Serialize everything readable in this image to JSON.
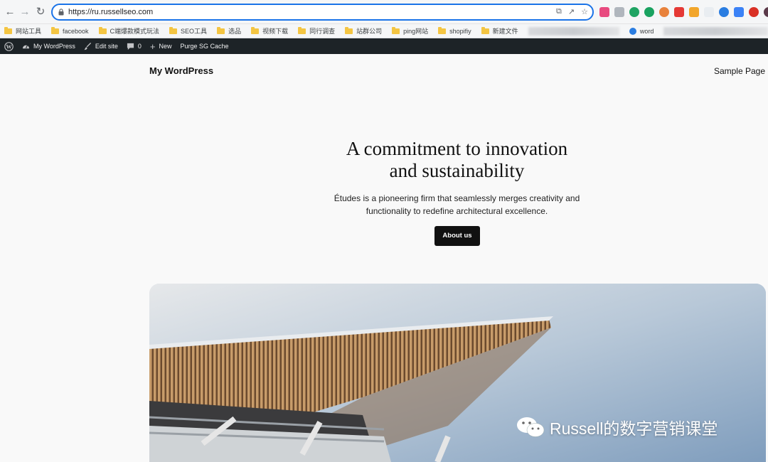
{
  "browser": {
    "url": "https://ru.russellseo.com",
    "bookmarks": [
      "网站工具",
      "facebook",
      "C端爆款模式玩法",
      "SEO工具",
      "选品",
      "视频下载",
      "同行调查",
      "站群公司",
      "ping网站",
      "shopifiy",
      "新建文件",
      "word"
    ]
  },
  "adminbar": {
    "site_label": "My WordPress",
    "edit_label": "Edit site",
    "comments_count": "0",
    "new_label": "New",
    "cache_label": "Purge SG Cache"
  },
  "site": {
    "title": "My WordPress",
    "nav_link": "Sample Page"
  },
  "hero": {
    "title_line1": "A commitment to innovation",
    "title_line2": "and sustainability",
    "text_line1": "Études is a pioneering firm that seamlessly merges creativity and",
    "text_line2": "functionality to redefine architectural excellence.",
    "cta_label": "About us"
  },
  "watermark": "Russell的数字营销课堂",
  "colors": {
    "accent": "#1a73e8",
    "adminbar": "#1d2327",
    "button": "#111111"
  }
}
